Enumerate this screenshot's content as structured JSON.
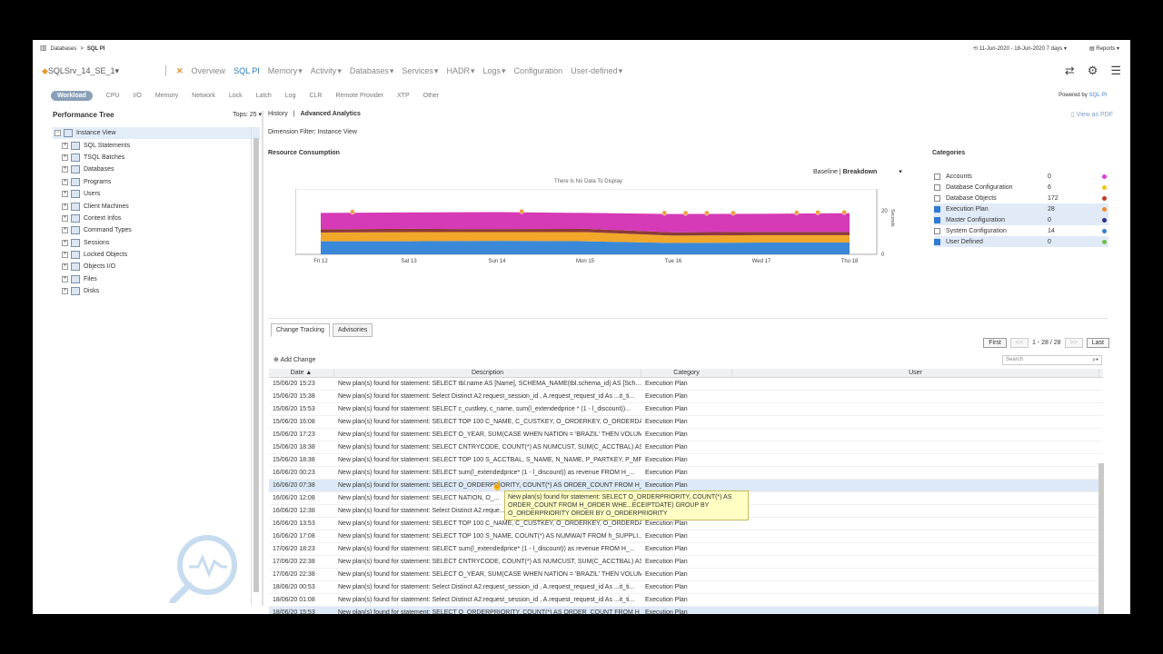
{
  "breadcrumb": {
    "root": "Databases",
    "sep": ">",
    "current": "SQL PI"
  },
  "daterange": "11-Jun-2020 - 18-Jun-2020 7 days",
  "reports": "Reports",
  "server": "SQLSrv_14_SE_1",
  "mainnav": [
    "Overview",
    "SQL PI",
    "Memory",
    "Activity",
    "Databases",
    "Services",
    "HADR",
    "Logs",
    "Configuration",
    "User-defined"
  ],
  "subnav": [
    "Workload",
    "CPU",
    "I/O",
    "Memory",
    "Network",
    "Lock",
    "Latch",
    "Log",
    "CLR",
    "Remote Provider",
    "XTP",
    "Other"
  ],
  "powered": {
    "label": "Powered by",
    "brand": "SQL PI"
  },
  "left": {
    "title": "Performance Tree",
    "tops": "Tops: 25",
    "tree": [
      "Instance View",
      "SQL Statements",
      "TSQL Batches",
      "Databases",
      "Programs",
      "Users",
      "Client Machines",
      "Context Infos",
      "Command Types",
      "Sessions",
      "Locked Objects",
      "Objects I/O",
      "Files",
      "Disks"
    ]
  },
  "right": {
    "tab_history": "History",
    "tab_sep": "|",
    "tab_advanced": "Advanced Analytics",
    "export": "View as PDF",
    "dimfilter": "Dimension Filter: Instance View",
    "rc_title": "Resource Consumption",
    "baseline": "Baseline",
    "breakdown": "Breakdown",
    "nodata": "There Is No Data To Display"
  },
  "chart_data": {
    "type": "area",
    "x": [
      "Fri 12",
      "Sat 13",
      "Sun 14",
      "Mon 15",
      "Tue 16",
      "Wed 17",
      "Thu 18"
    ],
    "ylabel": "Seconds",
    "ylim": [
      0,
      30
    ],
    "yticks": [
      0,
      20
    ],
    "series": [
      {
        "color": "#3a88d8",
        "values": [
          6,
          6,
          6.2,
          6,
          5.2,
          5.4,
          5.4
        ]
      },
      {
        "color": "#f1a72a",
        "values": [
          4,
          4.2,
          4,
          4.2,
          3.4,
          3.4,
          3.4
        ]
      },
      {
        "color": "#8c3a3a",
        "values": [
          1.5,
          1.5,
          1.4,
          1.5,
          1.5,
          1.5,
          1.5
        ]
      },
      {
        "color": "#d63ab6",
        "values": [
          7.5,
          7.5,
          7.8,
          7.3,
          8.4,
          8.3,
          8.6
        ]
      }
    ],
    "markers": [
      0.06,
      0.38,
      0.65,
      0.69,
      0.73,
      0.78,
      0.9,
      0.94,
      0.99
    ]
  },
  "categories": {
    "title": "Categories",
    "items": [
      {
        "name": "Accounts",
        "count": "0",
        "checked": false,
        "color": "#e23ad9"
      },
      {
        "name": "Database Configuration",
        "count": "6",
        "checked": false,
        "color": "#f2c518"
      },
      {
        "name": "Database Objects",
        "count": "172",
        "checked": false,
        "color": "#c0392b"
      },
      {
        "name": "Execution Plan",
        "count": "28",
        "checked": true,
        "color": "#f08c30"
      },
      {
        "name": "Master Configuration",
        "count": "0",
        "checked": true,
        "color": "#2c2c8c"
      },
      {
        "name": "System Configuration",
        "count": "14",
        "checked": false,
        "color": "#3a7bd5"
      },
      {
        "name": "User Defined",
        "count": "0",
        "checked": true,
        "color": "#6cc04a"
      }
    ]
  },
  "tabsB": [
    "Change Tracking",
    "Advisories"
  ],
  "pager": {
    "first": "First",
    "prev": "<<",
    "info": "1 - 28 / 28",
    "next": ">>",
    "last": "Last"
  },
  "addchange": "Add Change",
  "search_placeholder": "Search",
  "grid": {
    "headers": [
      "Date ▲",
      "Description",
      "Category",
      "User"
    ],
    "rows": [
      [
        "15/06/20 15:23",
        "New plan(s) found for statement: SELECT tbl.name AS [Name], SCHEMA_NAME(tbl.schema_id) AS [Sch...",
        "Execution Plan"
      ],
      [
        "15/06/20 15:38",
        "New plan(s) found for statement: Select Distinct A2.request_session_id , A.request_request_id As ...it_ti...",
        "Execution Plan"
      ],
      [
        "15/06/20 15:53",
        "New plan(s) found for statement: SELECT c_custkey, c_name, sum(l_extendedprice * (1 - l_discount))...",
        "Execution Plan"
      ],
      [
        "15/06/20 16:08",
        "New plan(s) found for statement: SELECT TOP 100 C_NAME, C_CUSTKEY, O_ORDERKEY, O_ORDERDA...",
        "Execution Plan"
      ],
      [
        "15/06/20 17:23",
        "New plan(s) found for statement: SELECT O_YEAR, SUM(CASE WHEN NATION = 'BRAZIL' THEN VOLUM...",
        "Execution Plan"
      ],
      [
        "15/06/20 18:38",
        "New plan(s) found for statement: SELECT CNTRYCODE, COUNT(*) AS NUMCUST, SUM(C_ACCTBAL) AS...",
        "Execution Plan"
      ],
      [
        "15/06/20 18:38",
        "New plan(s) found for statement: SELECT TOP 100 S_ACCTBAL, S_NAME, N_NAME, P_PARTKEY, P_MF...",
        "Execution Plan"
      ],
      [
        "16/06/20 00:23",
        "New plan(s) found for statement: SELECT sum(l_extendedprice* (1 - l_discount)) as revenue FROM H_...",
        "Execution Plan"
      ],
      [
        "16/06/20 07:38",
        "New plan(s) found for statement: SELECT O_ORDERPRIORITY, COUNT(*) AS ORDER_COUNT FROM H_...",
        "Execution Plan"
      ],
      [
        "16/06/20 12:08",
        "New plan(s) found for statement: SELECT NATION, O_...",
        ""
      ],
      [
        "16/06/20 12:38",
        "New plan(s) found for statement: Select Distinct A2.reque...",
        ""
      ],
      [
        "16/06/20 13:53",
        "New plan(s) found for statement: SELECT TOP 100 C_NAME, C_CUSTKEY, O_ORDERKEY, O_ORDERDA...",
        "Execution Plan"
      ],
      [
        "16/06/20 17:08",
        "New plan(s) found for statement: SELECT TOP 100 S_NAME, COUNT(*) AS NUMWAIT FROM h_SUPPLI...",
        "Execution Plan"
      ],
      [
        "17/06/20 18:23",
        "New plan(s) found for statement: SELECT sum(l_extendedprice* (1 - l_discount)) as revenue FROM H_...",
        "Execution Plan"
      ],
      [
        "17/06/20 22:38",
        "New plan(s) found for statement: SELECT CNTRYCODE, COUNT(*) AS NUMCUST, SUM(C_ACCTBAL) AS...",
        "Execution Plan"
      ],
      [
        "17/06/20 22:38",
        "New plan(s) found for statement: SELECT O_YEAR, SUM(CASE WHEN NATION = 'BRAZIL' THEN VOLUM...",
        "Execution Plan"
      ],
      [
        "18/06/20 00:53",
        "New plan(s) found for statement: Select Distinct A2.request_session_id , A.request_request_id As ...it_ti...",
        "Execution Plan"
      ],
      [
        "18/06/20 01:08",
        "New plan(s) found for statement: Select Distinct A2.request_session_id , A.request_request_id As ...it_ti...",
        "Execution Plan"
      ],
      [
        "18/06/20 15:53",
        "New plan(s) found for statement: SELECT O_ORDERPRIORITY, COUNT(*) AS ORDER_COUNT FROM H_...",
        "Execution Plan"
      ]
    ]
  },
  "tooltip": "New plan(s) found for statement: SELECT O_ORDERPRIORITY, COUNT(*) AS ORDER_COUNT FROM H_ORDER WHE...ECEIPTDATE) GROUP BY O_ORDERPRIORITY ORDER BY O_ORDERPRIORITY"
}
